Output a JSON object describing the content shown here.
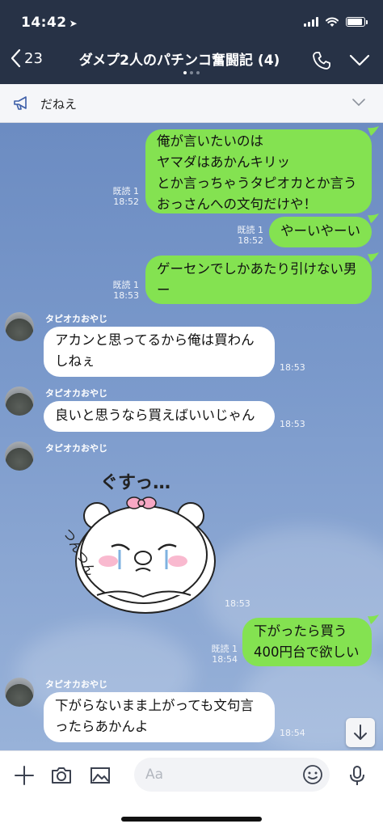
{
  "status_bar": {
    "time": "14:42"
  },
  "header": {
    "back_count": "23",
    "title": "ダメプ2人のパチンコ奮闘記 (4)"
  },
  "announcement": {
    "text": "だねえ"
  },
  "messages": [
    {
      "type": "outgoing",
      "lines": [
        "俺が言いたいのは",
        "ヤマダはあかんキリッ",
        "とか言っちゃうタピオカとか言う",
        "おっさんへの文句だけや！"
      ],
      "read": "既読 1",
      "time": "18:52"
    },
    {
      "type": "outgoing",
      "lines": [
        "やーいやーい"
      ],
      "read": "既読 1",
      "time": "18:52"
    },
    {
      "type": "outgoing",
      "lines": [
        "ゲーセンでしかあたり引けない男",
        "ー"
      ],
      "read": "既読 1",
      "time": "18:53"
    },
    {
      "type": "incoming",
      "sender": "タピオカおやじ",
      "lines": [
        "アカンと思ってるから俺は買わん",
        "しねぇ"
      ],
      "time": "18:53"
    },
    {
      "type": "incoming",
      "sender": "タピオカおやじ",
      "lines": [
        "良いと思うなら買えばいいじゃん"
      ],
      "time": "18:53"
    },
    {
      "type": "sticker",
      "sender": "タピオカおやじ",
      "time": "18:53",
      "sticker_text_top": "ぐすっ…",
      "sticker_text_side": "つんつん"
    },
    {
      "type": "outgoing",
      "lines": [
        "下がったら買う",
        "400円台で欲しい"
      ],
      "read": "既読 1",
      "time": "18:54"
    },
    {
      "type": "incoming",
      "sender": "タピオカおやじ",
      "lines": [
        "下がらないまま上がっても文句言",
        "ったらあかんよ"
      ],
      "time": "18:54"
    }
  ],
  "input": {
    "placeholder": "Aa"
  },
  "colors": {
    "header_bg": "#273246",
    "outgoing_bubble": "#84e251",
    "incoming_bubble": "#ffffff",
    "chat_bg": "#7a99cb"
  },
  "icons": {
    "status": [
      "location-arrow-icon",
      "signal-icon",
      "wifi-icon",
      "battery-icon"
    ],
    "header": [
      "back-chevron-icon",
      "phone-icon",
      "chevron-down-icon"
    ],
    "input": [
      "plus-icon",
      "camera-icon",
      "image-icon",
      "emoji-icon",
      "microphone-icon"
    ]
  }
}
